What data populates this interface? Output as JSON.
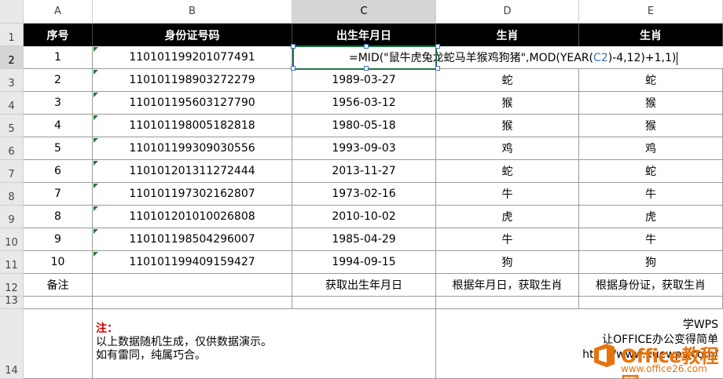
{
  "columns": [
    "A",
    "B",
    "C",
    "D",
    "E"
  ],
  "row_numbers": [
    "1",
    "2",
    "3",
    "4",
    "5",
    "6",
    "7",
    "8",
    "9",
    "10",
    "11",
    "12",
    "13",
    "14"
  ],
  "headers": [
    "序号",
    "身份证号码",
    "出生年月日",
    "生肖",
    "生肖"
  ],
  "rows": [
    {
      "seq": "1",
      "id": "110101199201077491",
      "birth": "",
      "zodiac_d": "",
      "zodiac_e": ""
    },
    {
      "seq": "2",
      "id": "110101198903272279",
      "birth": "1989-03-27",
      "zodiac_d": "蛇",
      "zodiac_e": "蛇"
    },
    {
      "seq": "3",
      "id": "110101195603127790",
      "birth": "1956-03-12",
      "zodiac_d": "猴",
      "zodiac_e": "猴"
    },
    {
      "seq": "4",
      "id": "110101198005182818",
      "birth": "1980-05-18",
      "zodiac_d": "猴",
      "zodiac_e": "猴"
    },
    {
      "seq": "5",
      "id": "110101199309030556",
      "birth": "1993-09-03",
      "zodiac_d": "鸡",
      "zodiac_e": "鸡"
    },
    {
      "seq": "6",
      "id": "110101201311272444",
      "birth": "2013-11-27",
      "zodiac_d": "蛇",
      "zodiac_e": "蛇"
    },
    {
      "seq": "7",
      "id": "110101197302162807",
      "birth": "1973-02-16",
      "zodiac_d": "牛",
      "zodiac_e": "牛"
    },
    {
      "seq": "8",
      "id": "110101201010026808",
      "birth": "2010-10-02",
      "zodiac_d": "虎",
      "zodiac_e": "虎"
    },
    {
      "seq": "9",
      "id": "110101198504296007",
      "birth": "1985-04-29",
      "zodiac_d": "牛",
      "zodiac_e": "牛"
    },
    {
      "seq": "10",
      "id": "110101199409159427",
      "birth": "1994-09-15",
      "zodiac_d": "狗",
      "zodiac_e": "狗"
    }
  ],
  "formula": {
    "prefix": "=MID(\"鼠牛虎兔龙蛇马羊猴鸡狗猪\",MOD(YEAR(",
    "ref": "C2",
    "suffix": ")-4,12)+1,1)"
  },
  "remarks": {
    "a": "备注",
    "b": "",
    "c": "获取出生年月日",
    "d": "根据年月日，获取生肖",
    "e": "根据身份证，获取生肖"
  },
  "note": {
    "title": "注：",
    "line1": "以上数据随机生成，仅供数据演示。",
    "line2": "如有雷同，纯属巧合。"
  },
  "brand": {
    "line1": "学WPS",
    "line2": "让OFFICE办公变得简单",
    "line3": "http://www.xuewps.com/"
  },
  "watermark": {
    "text": "Office教程网",
    "url": "www.office26.com"
  },
  "colors": {
    "header_bg": "#000000",
    "header_fg": "#ffffff",
    "selection": "#217346",
    "reference": "#3b6fc4",
    "note_red": "#d40000",
    "watermark": "#e8730e"
  }
}
